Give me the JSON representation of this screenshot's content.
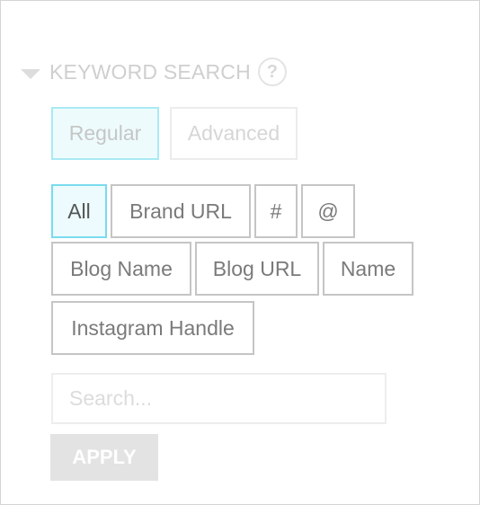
{
  "section": {
    "title": "KEYWORD SEARCH",
    "help_glyph": "?",
    "caret_icon": "caret-down-icon",
    "help_icon": "question-circle-icon"
  },
  "mode_toggle": {
    "regular_label": "Regular",
    "advanced_label": "Advanced",
    "selected": "Regular"
  },
  "filters": {
    "selected": "All",
    "items": [
      {
        "label": "All"
      },
      {
        "label": "Brand URL"
      },
      {
        "label": "#"
      },
      {
        "label": "@"
      },
      {
        "label": "Blog Name"
      },
      {
        "label": "Blog URL"
      },
      {
        "label": "Name"
      },
      {
        "label": "Instagram Handle"
      }
    ]
  },
  "search": {
    "placeholder": "Search...",
    "value": ""
  },
  "apply": {
    "label": "APPLY"
  },
  "colors": {
    "active_border": "#79dbee",
    "active_fill": "#edfbfe",
    "chip_border": "#c5c5c5",
    "chip_text": "#7a7a7a",
    "disabled_button": "#e3e3e3"
  }
}
